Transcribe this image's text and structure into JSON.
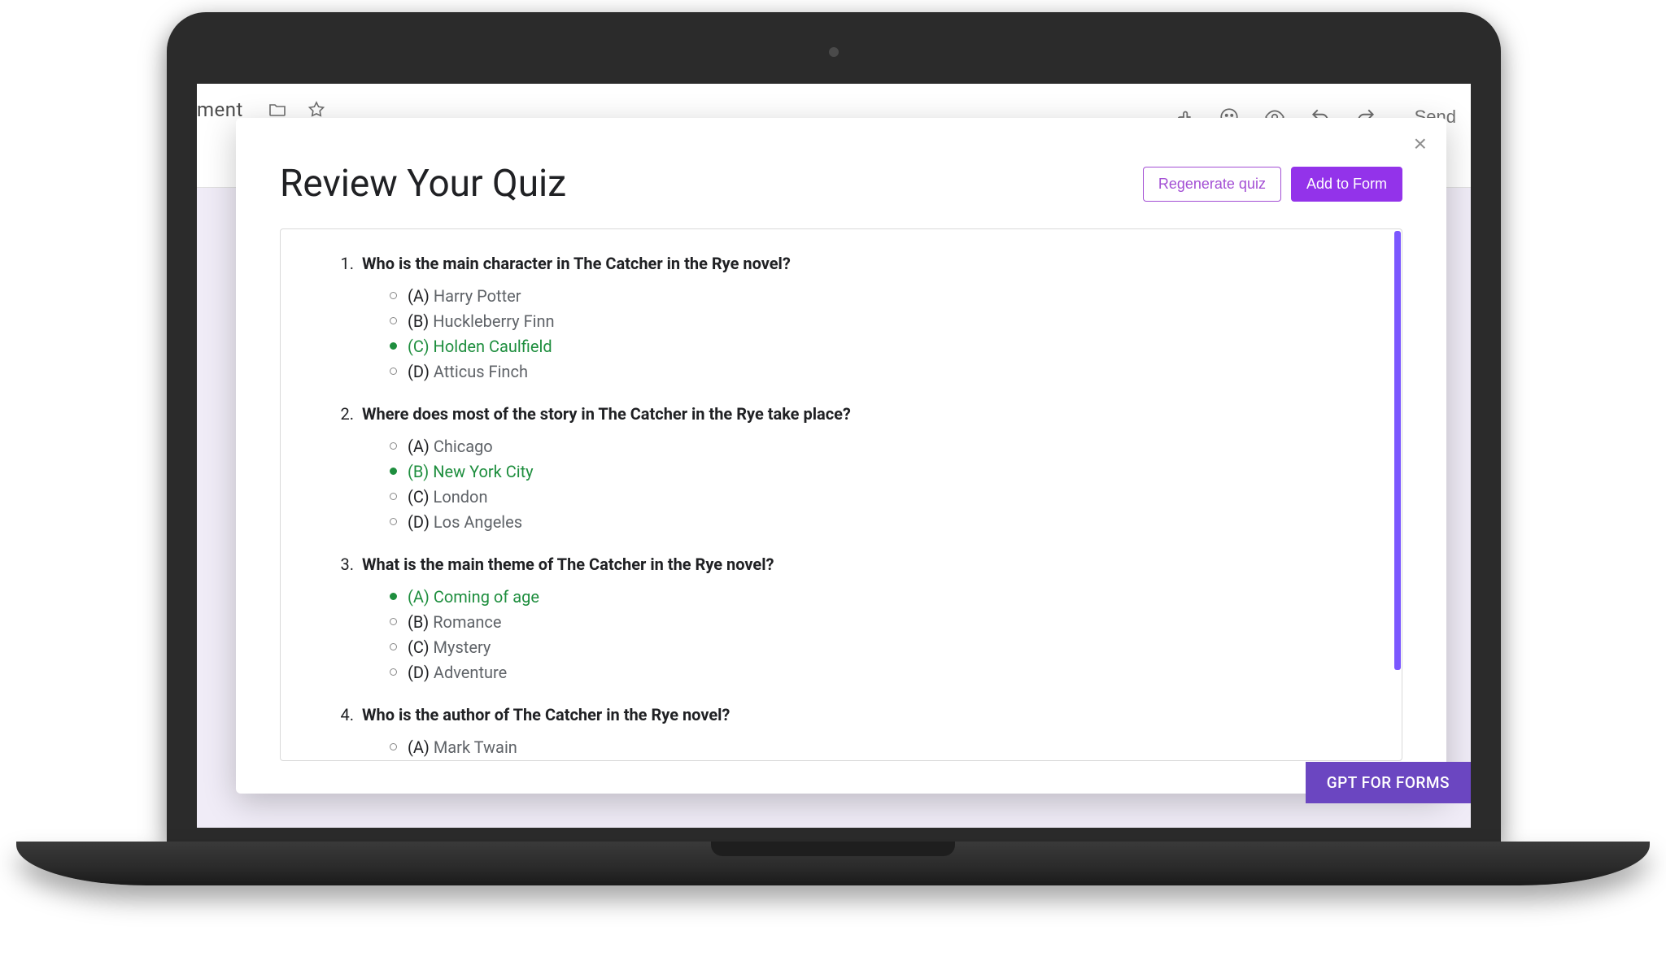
{
  "header": {
    "doc_name_fragment": "ment",
    "send_label": "Send"
  },
  "modal": {
    "title": "Review Your Quiz",
    "regenerate_label": "Regenerate quiz",
    "add_label": "Add to Form"
  },
  "gpt_badge": "GPT FOR FORMS",
  "questions": [
    {
      "num": "1.",
      "text": "Who is the main character in The Catcher in the Rye novel?",
      "opts": [
        {
          "letter": "(A)",
          "text": "Harry Potter",
          "correct": false
        },
        {
          "letter": "(B)",
          "text": "Huckleberry Finn",
          "correct": false
        },
        {
          "letter": "(C)",
          "text": "Holden Caulfield",
          "correct": true
        },
        {
          "letter": "(D)",
          "text": "Atticus Finch",
          "correct": false
        }
      ]
    },
    {
      "num": "2.",
      "text": "Where does most of the story in The Catcher in the Rye take place?",
      "opts": [
        {
          "letter": "(A)",
          "text": "Chicago",
          "correct": false
        },
        {
          "letter": "(B)",
          "text": "New York City",
          "correct": true
        },
        {
          "letter": "(C)",
          "text": "London",
          "correct": false
        },
        {
          "letter": "(D)",
          "text": "Los Angeles",
          "correct": false
        }
      ]
    },
    {
      "num": "3.",
      "text": "What is the main theme of The Catcher in the Rye novel?",
      "opts": [
        {
          "letter": "(A)",
          "text": "Coming of age",
          "correct": true
        },
        {
          "letter": "(B)",
          "text": "Romance",
          "correct": false
        },
        {
          "letter": "(C)",
          "text": "Mystery",
          "correct": false
        },
        {
          "letter": "(D)",
          "text": "Adventure",
          "correct": false
        }
      ]
    },
    {
      "num": "4.",
      "text": "Who is the author of The Catcher in the Rye novel?",
      "opts": [
        {
          "letter": "(A)",
          "text": "Mark Twain",
          "correct": false
        }
      ]
    }
  ]
}
